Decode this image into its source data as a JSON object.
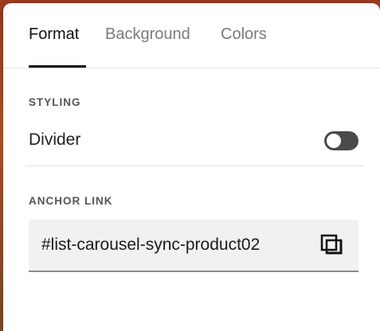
{
  "tabs": [
    {
      "label": "Format",
      "active": true
    },
    {
      "label": "Background",
      "active": false
    },
    {
      "label": "Colors",
      "active": false
    }
  ],
  "styling": {
    "section_label": "STYLING",
    "divider_label": "Divider",
    "divider_enabled": false
  },
  "anchor": {
    "section_label": "ANCHOR LINK",
    "value": "#list-carousel-sync-product02",
    "copy_icon": "copy-icon"
  },
  "colors": {
    "accent": "#111111",
    "muted_text": "#7a7a7a",
    "toggle_off": "#4a4a4a",
    "field_bg": "#f1f1f1"
  }
}
